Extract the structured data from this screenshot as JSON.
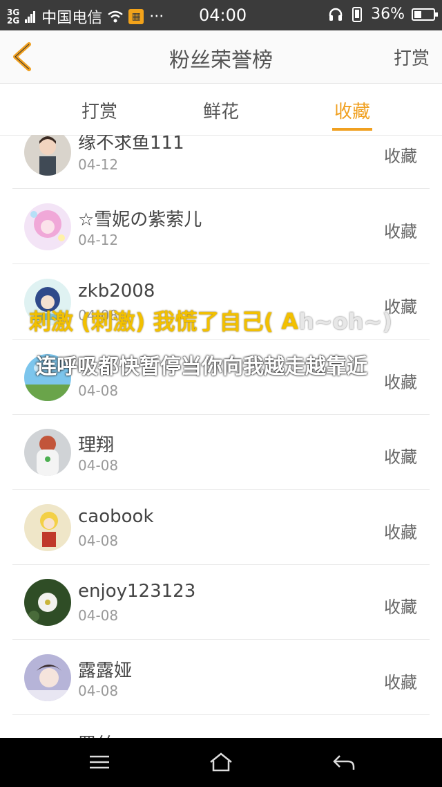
{
  "status": {
    "net_top": "3G",
    "net_bottom": "2G",
    "carrier": "中国电信",
    "more": "···",
    "time": "04:00",
    "battery": "36%"
  },
  "header": {
    "title": "粉丝荣誉榜",
    "right_action": "打赏"
  },
  "tabs": [
    {
      "label": "打赏",
      "active": false
    },
    {
      "label": "鲜花",
      "active": false
    },
    {
      "label": "收藏",
      "active": true
    }
  ],
  "rows": [
    {
      "name": "缘不求鱼111",
      "date": "04-12",
      "action": "收藏"
    },
    {
      "name": "☆雪妮の紫萦儿",
      "date": "04-12",
      "action": "收藏"
    },
    {
      "name": "zkb2008",
      "date": "04-08",
      "action": "收藏"
    },
    {
      "name": "",
      "date": "04-08",
      "action": "收藏"
    },
    {
      "name": "理翔",
      "date": "04-08",
      "action": "收藏"
    },
    {
      "name": "caobook",
      "date": "04-08",
      "action": "收藏"
    },
    {
      "name": "enjoy123123",
      "date": "04-08",
      "action": "收藏"
    },
    {
      "name": "露露娅",
      "date": "04-08",
      "action": "收藏"
    },
    {
      "name": "罗丝",
      "date": "",
      "action": ""
    }
  ],
  "lyrics": {
    "line1_main": "刺激 (刺激)  我慌了自己( A",
    "line1_tail": "h~oh~)",
    "line2": "连呼吸都快暂停当你向我越走越靠近"
  }
}
